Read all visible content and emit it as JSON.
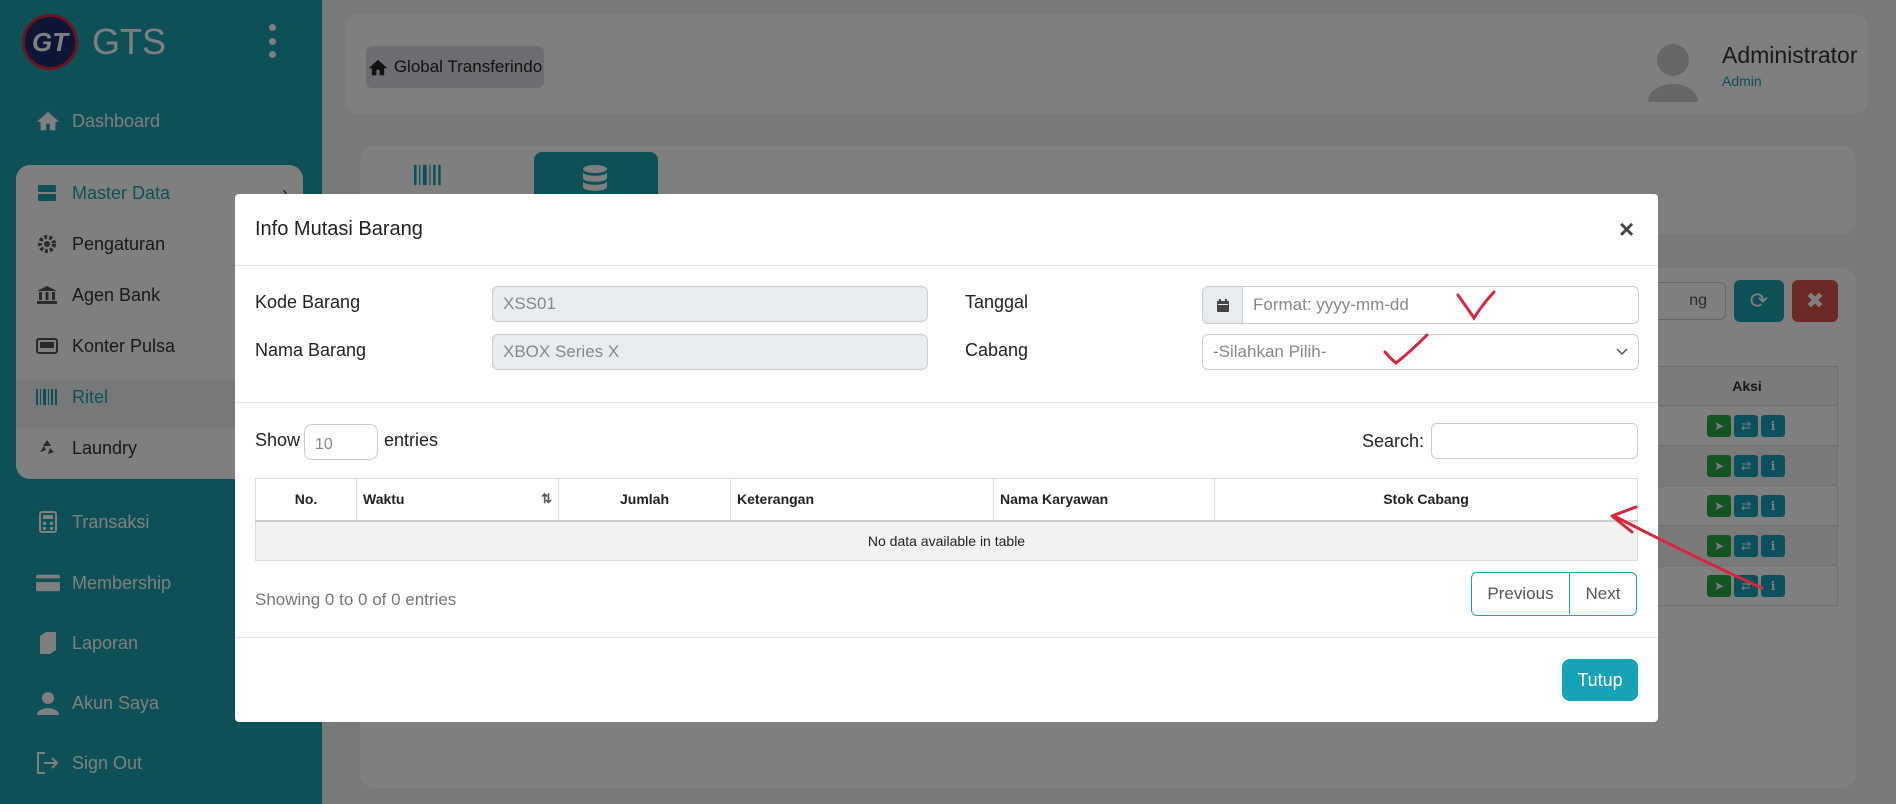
{
  "sidebar": {
    "brand": {
      "logo_text": "GT",
      "name": "GTS"
    },
    "items": [
      {
        "label": "Dashboard",
        "icon": "home-icon"
      },
      {
        "label": "Transaksi",
        "icon": "calculator-icon"
      },
      {
        "label": "Membership",
        "icon": "card-icon"
      },
      {
        "label": "Laporan",
        "icon": "book-icon"
      },
      {
        "label": "Akun Saya",
        "icon": "user-icon"
      },
      {
        "label": "Sign Out",
        "icon": "sign-out-icon"
      }
    ],
    "master_data": {
      "label": "Master Data",
      "children": [
        {
          "label": "Pengaturan",
          "icon": "gear-icon"
        },
        {
          "label": "Agen Bank",
          "icon": "bank-icon"
        },
        {
          "label": "Konter Pulsa",
          "icon": "device-icon"
        },
        {
          "label": "Ritel",
          "icon": "barcode-icon"
        },
        {
          "label": "Laundry",
          "icon": "recycle-icon"
        }
      ]
    }
  },
  "header": {
    "home_label": "Global Transferindo",
    "user_name": "Administrator",
    "user_role": "Admin"
  },
  "background": {
    "search_partial": "ng",
    "table_header": "Aksi"
  },
  "modal": {
    "title": "Info Mutasi Barang",
    "close": "×",
    "kode_barang_label": "Kode Barang",
    "kode_barang_value": "XSS01",
    "nama_barang_label": "Nama Barang",
    "nama_barang_value": "XBOX Series X",
    "tanggal_label": "Tanggal",
    "tanggal_placeholder": "Format: yyyy-mm-dd",
    "cabang_label": "Cabang",
    "cabang_selected": "-Silahkan Pilih-",
    "show_label": "Show",
    "entries_value": "10",
    "entries_label": "entries",
    "search_label": "Search:",
    "table": {
      "columns": [
        "No.",
        "Waktu",
        "Jumlah",
        "Keterangan",
        "Nama Karyawan",
        "Stok Cabang"
      ],
      "empty_text": "No data available in table"
    },
    "info": "Showing 0 to 0 of 0 entries",
    "pager": {
      "previous": "Previous",
      "next": "Next"
    },
    "footer_button": "Tutup"
  },
  "colors": {
    "primary": "#1aa3ae",
    "danger": "#d9534f",
    "success": "#28a745",
    "annotation": "#d7263d"
  }
}
